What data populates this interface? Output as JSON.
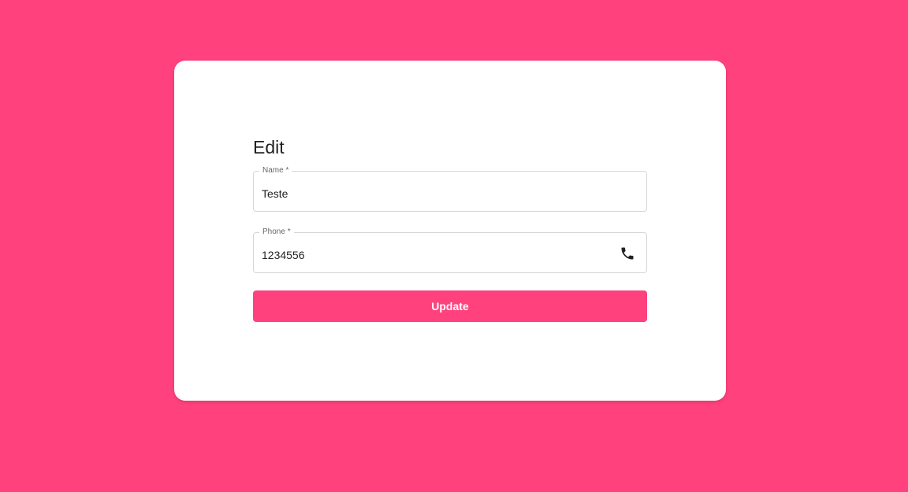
{
  "form": {
    "title": "Edit",
    "name_field": {
      "label": "Name *",
      "value": "Teste"
    },
    "phone_field": {
      "label": "Phone *",
      "value": "1234556",
      "icon": "phone-icon"
    },
    "update_label": "Update"
  },
  "colors": {
    "background": "#ff417d",
    "card": "#ffffff",
    "button": "#ff417d"
  }
}
